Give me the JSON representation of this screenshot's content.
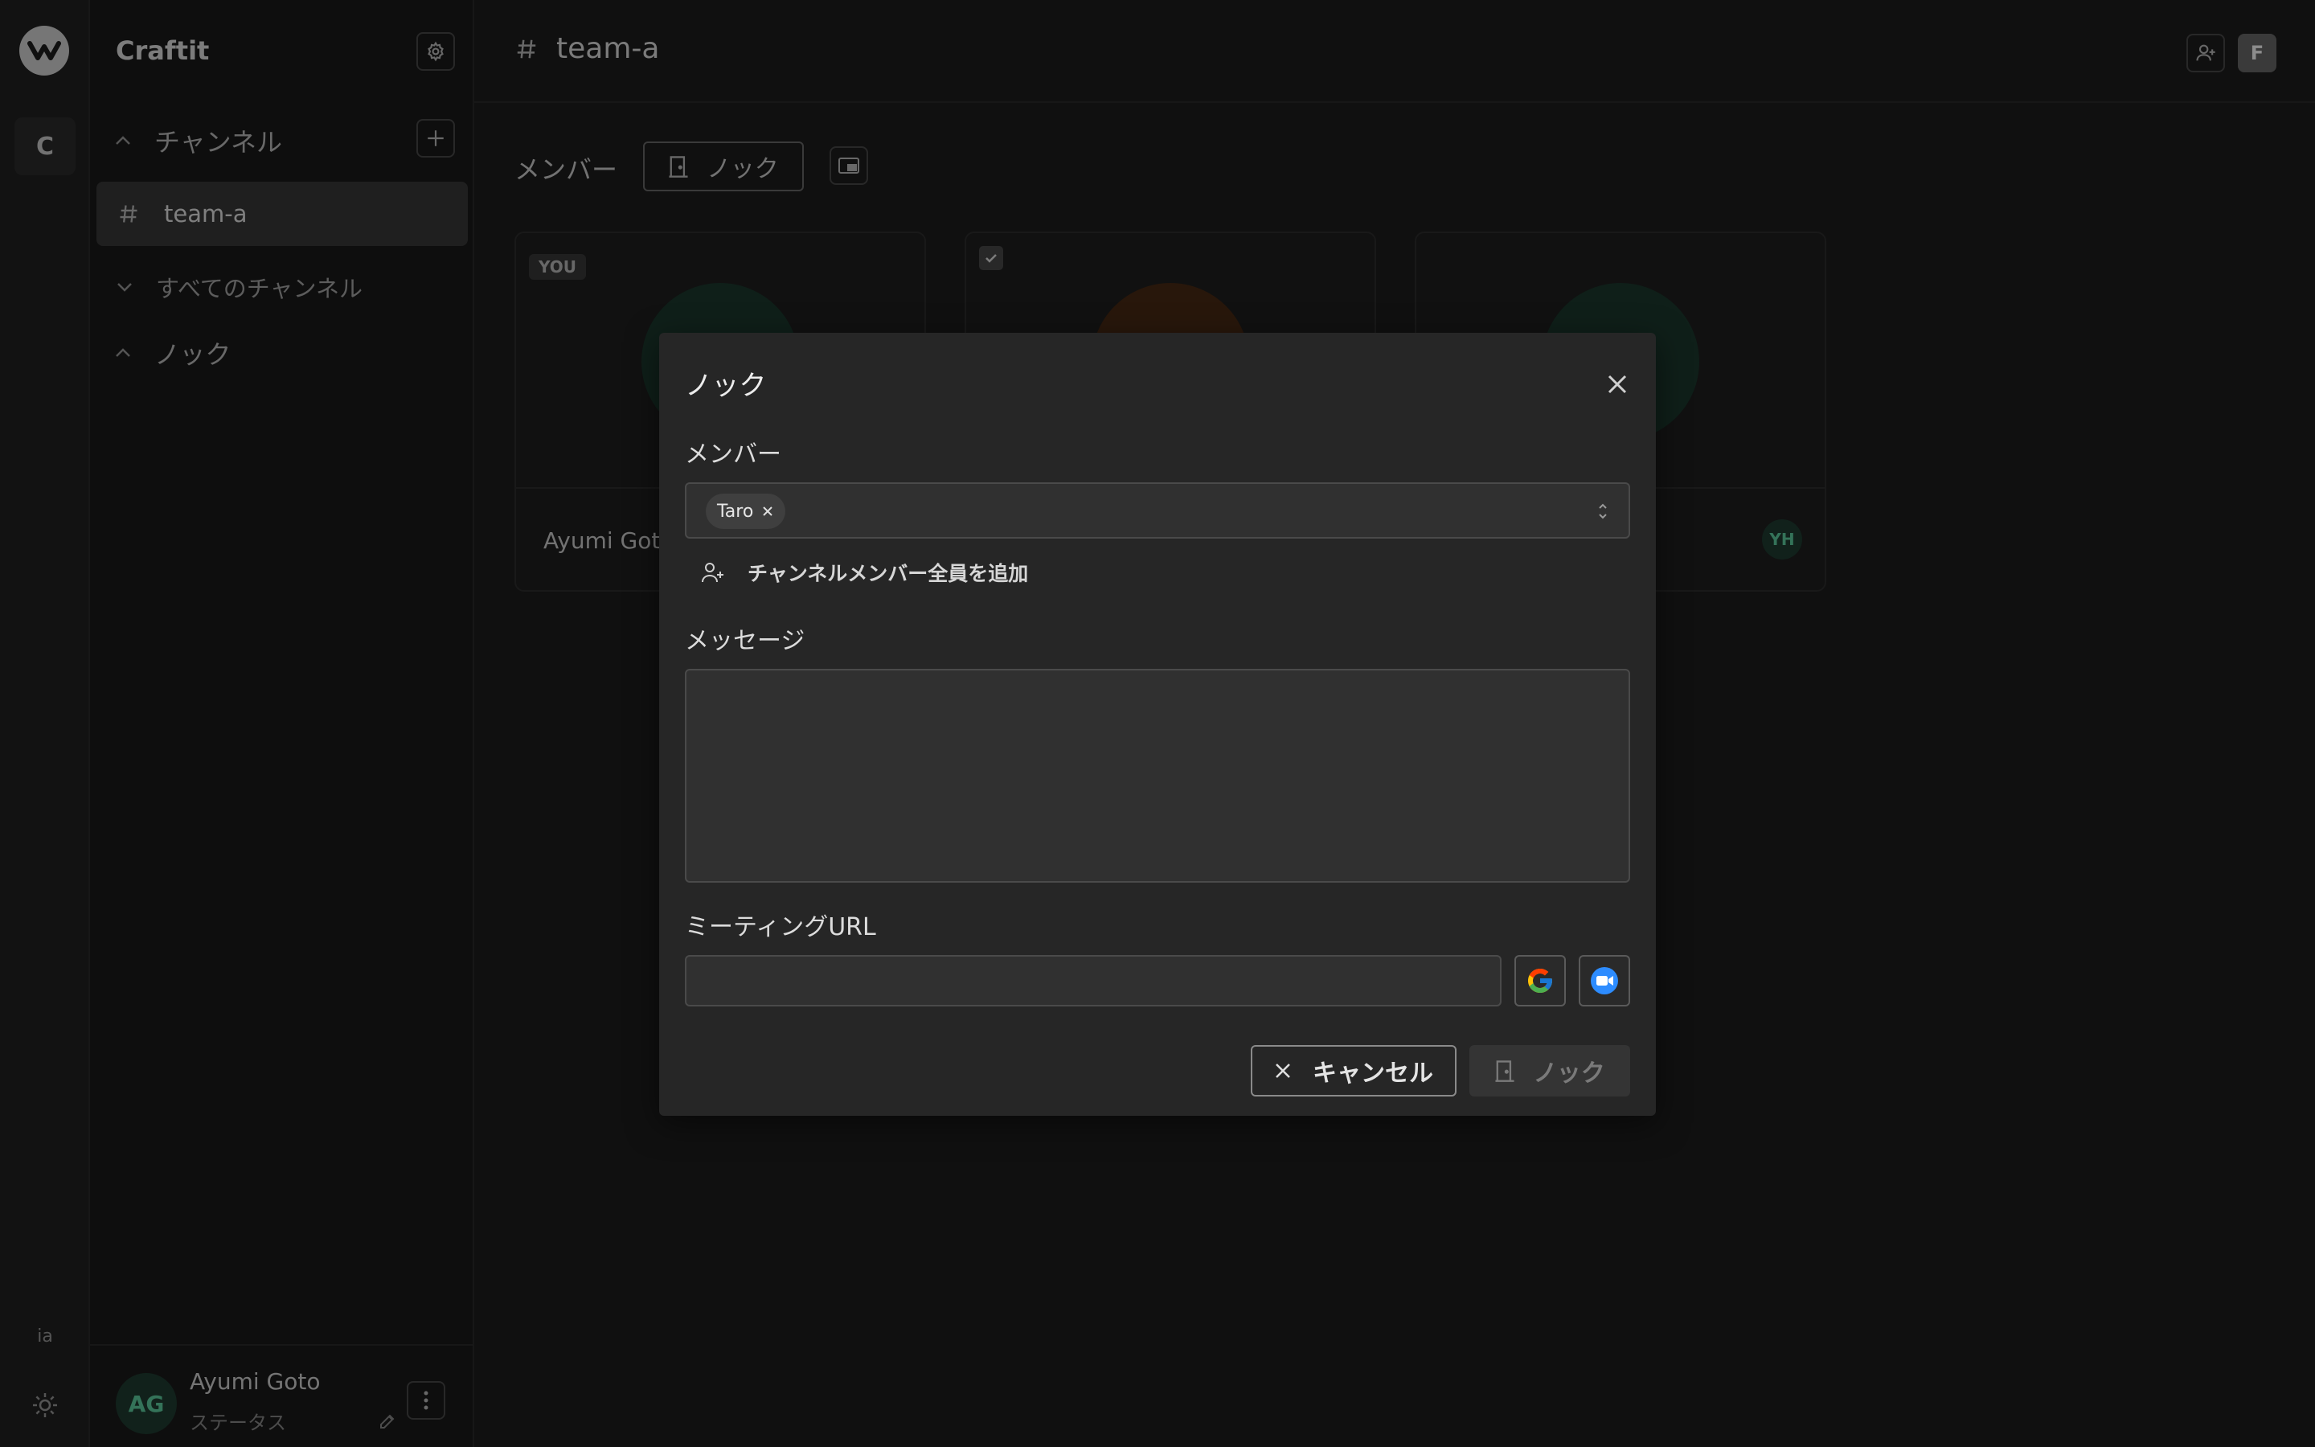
{
  "workspace": {
    "name": "Craftit",
    "tile_letter": "C",
    "rail_label": "ia"
  },
  "sidebar": {
    "channels_label": "チャンネル",
    "active_channel": "team-a",
    "all_channels": "すべてのチャンネル",
    "knock_section": "ノック"
  },
  "user": {
    "initials": "AG",
    "name": "Ayumi Goto",
    "status": "ステータス"
  },
  "main": {
    "channel": "team-a",
    "members_label": "メンバー",
    "knock_button": "ノック",
    "top_avatar": "F",
    "cards": [
      {
        "badge": "YOU",
        "name": "Ayumi Goto"
      },
      {
        "badge": "",
        "name": ""
      },
      {
        "badge": "",
        "name": "",
        "initials": "YH"
      }
    ]
  },
  "modal": {
    "title": "ノック",
    "members_label": "メンバー",
    "chips": [
      "Taro"
    ],
    "add_all": "チャンネルメンバー全員を追加",
    "message_label": "メッセージ",
    "message_value": "",
    "url_label": "ミーティングURL",
    "url_value": "",
    "cancel": "キャンセル",
    "submit": "ノック"
  },
  "colors": {
    "accent_green": "#5fd1a2",
    "zoom_blue": "#2d8cff"
  }
}
